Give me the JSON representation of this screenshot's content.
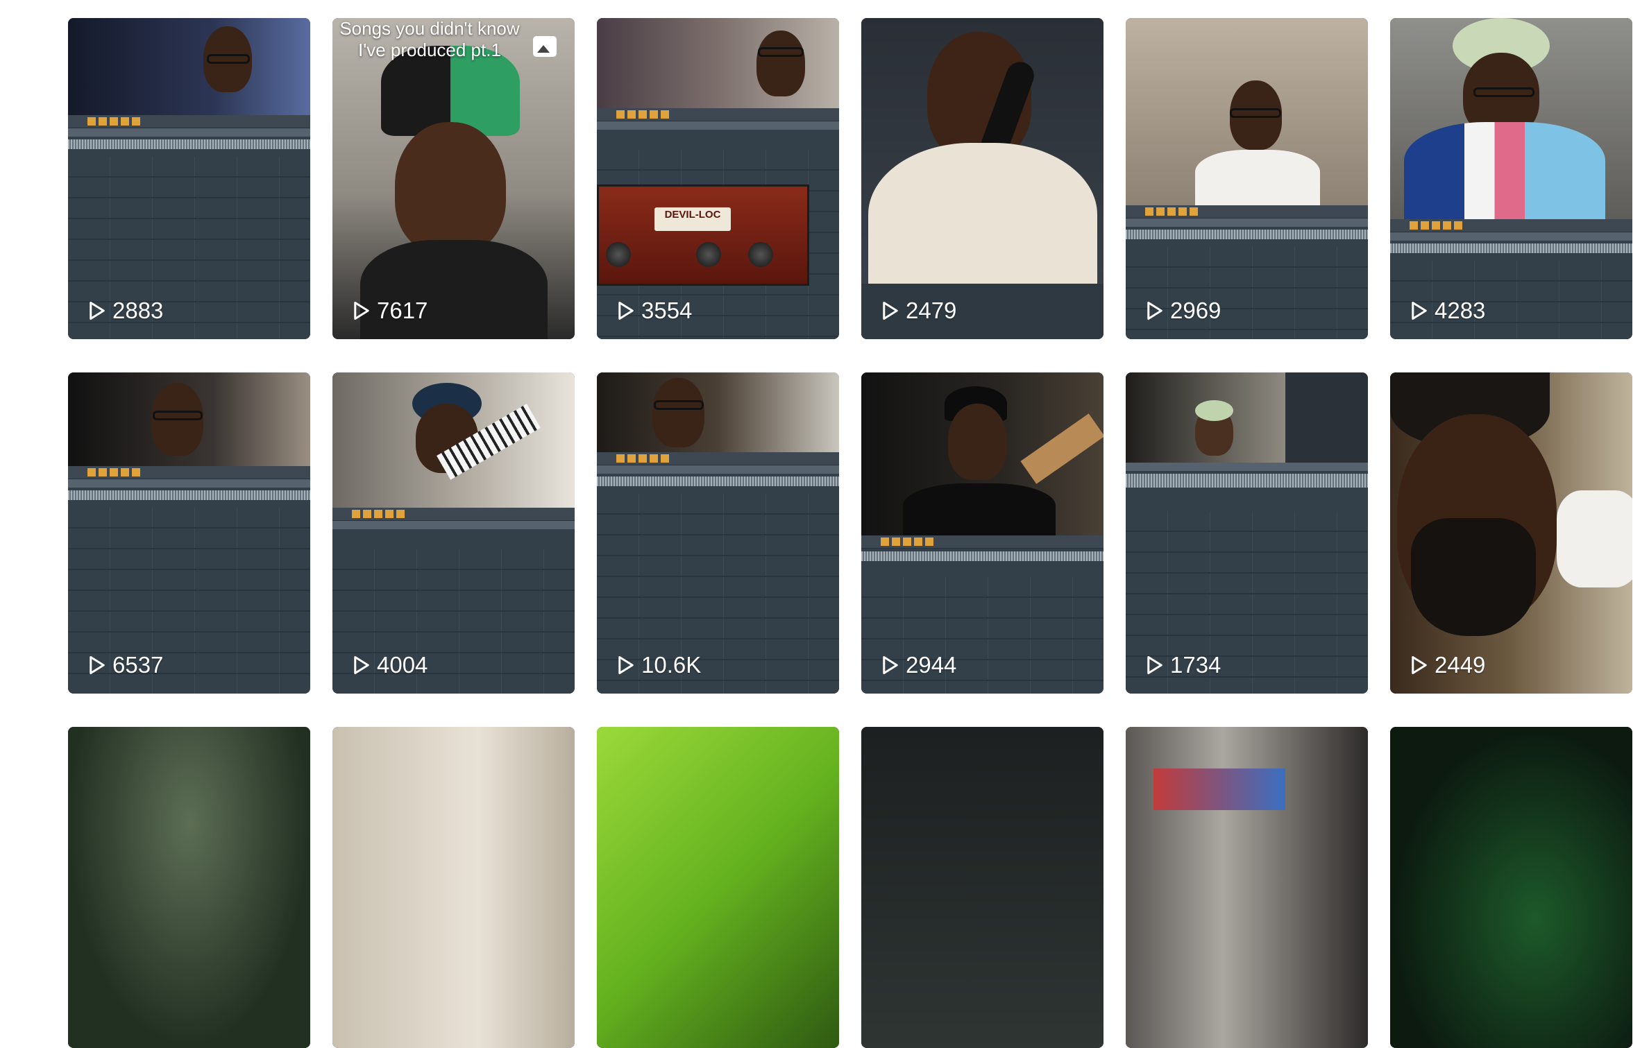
{
  "videos": [
    {
      "views": "2883",
      "theme": "daw-webcam"
    },
    {
      "views": "7617",
      "theme": "selfie-beanie",
      "caption_line1": "Songs you didn't know",
      "caption_line2": "I've produced pt.1",
      "photo_icon": "photo-icon"
    },
    {
      "views": "3554",
      "theme": "daw-plugin",
      "plugin_name": "DEVIL-LOC"
    },
    {
      "views": "2479",
      "theme": "phone-call"
    },
    {
      "views": "2969",
      "theme": "studio-daw"
    },
    {
      "views": "4283",
      "theme": "hat-daw"
    },
    {
      "views": "6537",
      "theme": "daw-webcam"
    },
    {
      "views": "4004",
      "theme": "keyboard-daw"
    },
    {
      "views": "10.6K",
      "theme": "daw-webcam-dark"
    },
    {
      "views": "2944",
      "theme": "guitar-daw"
    },
    {
      "views": "1734",
      "theme": "daw-zoom"
    },
    {
      "views": "2449",
      "theme": "beard-car"
    },
    {
      "theme": "dark-green"
    },
    {
      "theme": "room-light"
    },
    {
      "theme": "neon-green"
    },
    {
      "theme": "dark-street"
    },
    {
      "theme": "car-screen"
    },
    {
      "theme": "dark-studio"
    }
  ],
  "icons": {
    "play": "play-icon"
  }
}
